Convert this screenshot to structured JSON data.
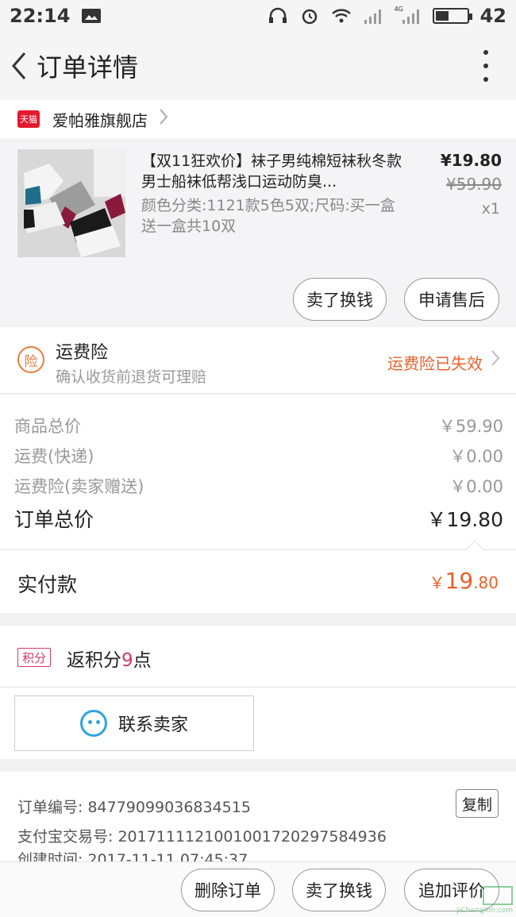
{
  "status_bar": {
    "time": "22:14",
    "battery": "42",
    "battery_level": 0.42,
    "network": "4G"
  },
  "nav": {
    "title": "订单详情",
    "back_icon": "chevron-left-icon",
    "more_icon": "more-vertical-icon"
  },
  "shop": {
    "badge": "天猫",
    "name": "爱帕雅旗舰店"
  },
  "product": {
    "title": "【双11狂欢价】袜子男纯棉短袜秋冬款男士船袜低帮浅口运动防臭...",
    "sku": "颜色分类:1121款5色5双;尺码:买一盒送一盒共10双",
    "price": "¥19.80",
    "original_price": "¥59.90",
    "quantity": "x1",
    "actions": [
      "卖了换钱",
      "申请售后"
    ]
  },
  "insurance": {
    "icon_label": "险",
    "title": "运费险",
    "subtitle": "确认收货前退货可理赔",
    "status": "运费险已失效"
  },
  "totals": [
    {
      "label": "商品总价",
      "value": "￥59.90"
    },
    {
      "label": "运费(快递)",
      "value": "￥0.00"
    },
    {
      "label": "运费险(卖家赠送)",
      "value": "￥0.00"
    },
    {
      "label": "订单总价",
      "value": "￥19.80"
    }
  ],
  "paid": {
    "label": "实付款",
    "currency": "￥",
    "int": "19",
    "dec": ".80"
  },
  "points": {
    "badge": "积分",
    "prefix": "返积分",
    "value": "9",
    "suffix": "点"
  },
  "contact": {
    "label": "联系卖家"
  },
  "order_info": {
    "order_no": "订单编号: 84779099036834515",
    "alipay_no": "支付宝交易号: 2017111121001001720297584936",
    "created": "创建时间: 2017-11-11 07:45:37",
    "copy_label": "复制"
  },
  "bottom_actions": [
    "删除订单",
    "卖了换钱",
    "追加评价"
  ],
  "watermark": {
    "text": "JiChengXin.com"
  },
  "colors": {
    "accent_orange": "#e8622c",
    "points_pink": "#d33a66",
    "tmall_red": "#e4192e",
    "chat_blue": "#2ea3e3"
  }
}
